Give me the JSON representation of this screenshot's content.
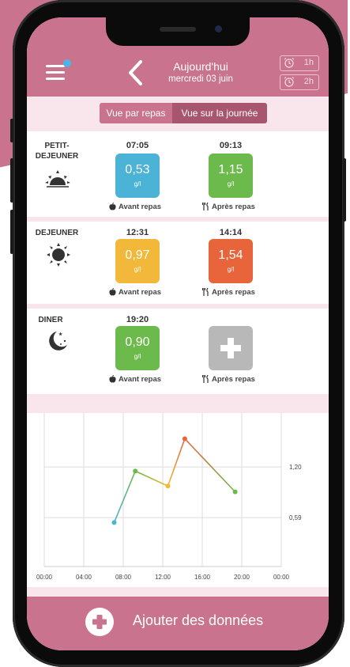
{
  "header": {
    "title": "Aujourd'hui",
    "date": "mercredi 03 juin",
    "alarms": [
      {
        "label": "1h"
      },
      {
        "label": "2h"
      }
    ]
  },
  "toggle": {
    "left": "Vue par repas",
    "right": "Vue sur la journée"
  },
  "meals": [
    {
      "name": "PETIT-\nDEJEUNER",
      "icon": "sunrise-icon",
      "before": {
        "time": "07:05",
        "value": "0,53",
        "unit": "g/l",
        "color": "#4ab3d6",
        "label": "Avant repas"
      },
      "after": {
        "time": "09:13",
        "value": "1,15",
        "unit": "g/l",
        "color": "#6cba4b",
        "label": "Après repas"
      }
    },
    {
      "name": "DEJEUNER",
      "icon": "sun-icon",
      "before": {
        "time": "12:31",
        "value": "0,97",
        "unit": "g/l",
        "color": "#f2b839",
        "label": "Avant repas"
      },
      "after": {
        "time": "14:14",
        "value": "1,54",
        "unit": "g/l",
        "color": "#e8643a",
        "label": "Après repas"
      }
    },
    {
      "name": "DINER",
      "icon": "moon-icon",
      "before": {
        "time": "19:20",
        "value": "0,90",
        "unit": "g/l",
        "color": "#6cba4b",
        "label": "Avant repas"
      },
      "after": {
        "time": "",
        "value": "",
        "unit": "",
        "color": "#b8b8b8",
        "label": "Après repas"
      }
    }
  ],
  "chart_data": {
    "type": "line",
    "x_labels": [
      "00:00",
      "04:00",
      "08:00",
      "12:00",
      "16:00",
      "20:00",
      "00:00"
    ],
    "xlim": [
      0,
      24
    ],
    "y_ticks": [
      {
        "value": 1.2,
        "label": "1,20"
      },
      {
        "value": 0.59,
        "label": "0,59"
      }
    ],
    "points": [
      {
        "x": 7.08,
        "y": 0.53,
        "color": "#4ab3d6"
      },
      {
        "x": 9.22,
        "y": 1.15,
        "color": "#6cba4b"
      },
      {
        "x": 12.52,
        "y": 0.97,
        "color": "#f2b839"
      },
      {
        "x": 14.23,
        "y": 1.54,
        "color": "#e8643a"
      },
      {
        "x": 19.33,
        "y": 0.9,
        "color": "#6cba4b"
      }
    ]
  },
  "footer": {
    "label": "Ajouter des données"
  }
}
